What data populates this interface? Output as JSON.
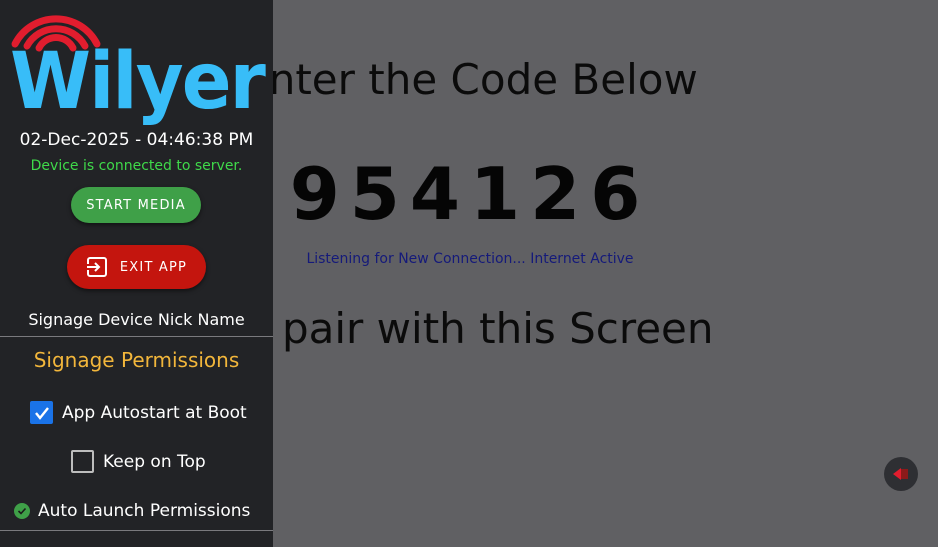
{
  "main": {
    "heading_top": "Enter the Code Below",
    "pairing_code": "954126",
    "status_message": "Listening for New Connection... Internet Active",
    "heading_bottom": "to pair with this Screen",
    "floating_button_icon": "exit-arrow-icon"
  },
  "sidebar": {
    "logo_text": "Wilyer",
    "datetime": "02-Dec-2025 - 04:46:38 PM",
    "connection_status": "Device is connected to server.",
    "start_media_label": "START MEDIA",
    "exit_app_label": "EXIT APP",
    "nickname_label": "Signage Device Nick Name",
    "permissions_title": "Signage Permissions",
    "permissions": {
      "autostart": {
        "label": "App Autostart at Boot",
        "checked": true
      },
      "keep_on_top": {
        "label": "Keep on Top",
        "checked": false
      },
      "auto_launch": {
        "label": "Auto Launch Permissions",
        "granted": true
      }
    }
  },
  "colors": {
    "background": "#606063",
    "sidebar": "#222326",
    "logo_blue": "#38bdf8",
    "logo_red": "#e11d2e",
    "start_button": "#3fa048",
    "exit_button": "#c4150e",
    "connected_text": "#3fd94a",
    "permissions_title": "#f2b63b",
    "checkbox_checked": "#1a73e8",
    "status_message": "#151a7a"
  }
}
